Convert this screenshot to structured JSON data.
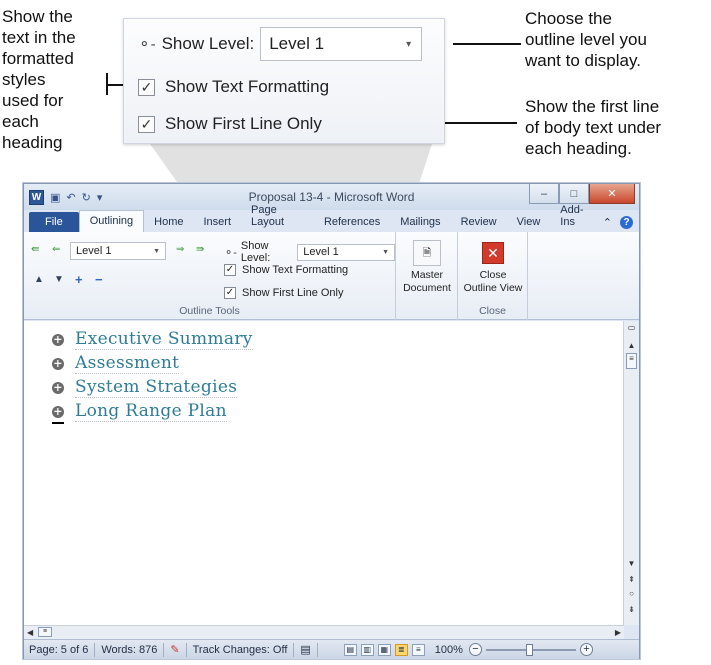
{
  "callouts": {
    "left": [
      "Show the",
      "text in the",
      "formatted",
      "styles",
      "used for",
      "each",
      "heading"
    ],
    "right_top": [
      "Choose the",
      "outline level you",
      "want to display."
    ],
    "right_mid": [
      "Show the first line",
      "of body text under",
      "each heading."
    ]
  },
  "zoom_panel": {
    "show_level_label": "Show Level:",
    "show_level_value": "Level 1",
    "show_text_formatting": "Show Text Formatting",
    "show_first_line_only": "Show First Line Only"
  },
  "window": {
    "title": "Proposal 13-4 - Microsoft Word",
    "logo": "W",
    "tabs": [
      "File",
      "Outlining",
      "Home",
      "Insert",
      "Page Layout",
      "References",
      "Mailings",
      "Review",
      "View",
      "Add-Ins"
    ],
    "active_tab": "Outlining"
  },
  "ribbon": {
    "level_value": "Level 1",
    "show_level_label": "Show Level:",
    "show_level_value": "Level 1",
    "show_text_formatting": "Show Text Formatting",
    "show_first_line_only": "Show First Line Only",
    "outline_tools_label": "Outline Tools",
    "master_document": [
      "Master",
      "Document"
    ],
    "close_outline_view": [
      "Close",
      "Outline View"
    ],
    "close_group_label": "Close"
  },
  "document": {
    "headings": [
      "Executive Summary",
      "Assessment",
      "System Strategies",
      "Long Range Plan"
    ]
  },
  "statusbar": {
    "page": "Page: 5 of 6",
    "words": "Words: 876",
    "track_changes": "Track Changes: Off",
    "zoom": "100%"
  },
  "colors": {
    "heading_teal": "#2e7c96",
    "file_tab_blue": "#2a5699",
    "close_red": "#d23b2c"
  }
}
